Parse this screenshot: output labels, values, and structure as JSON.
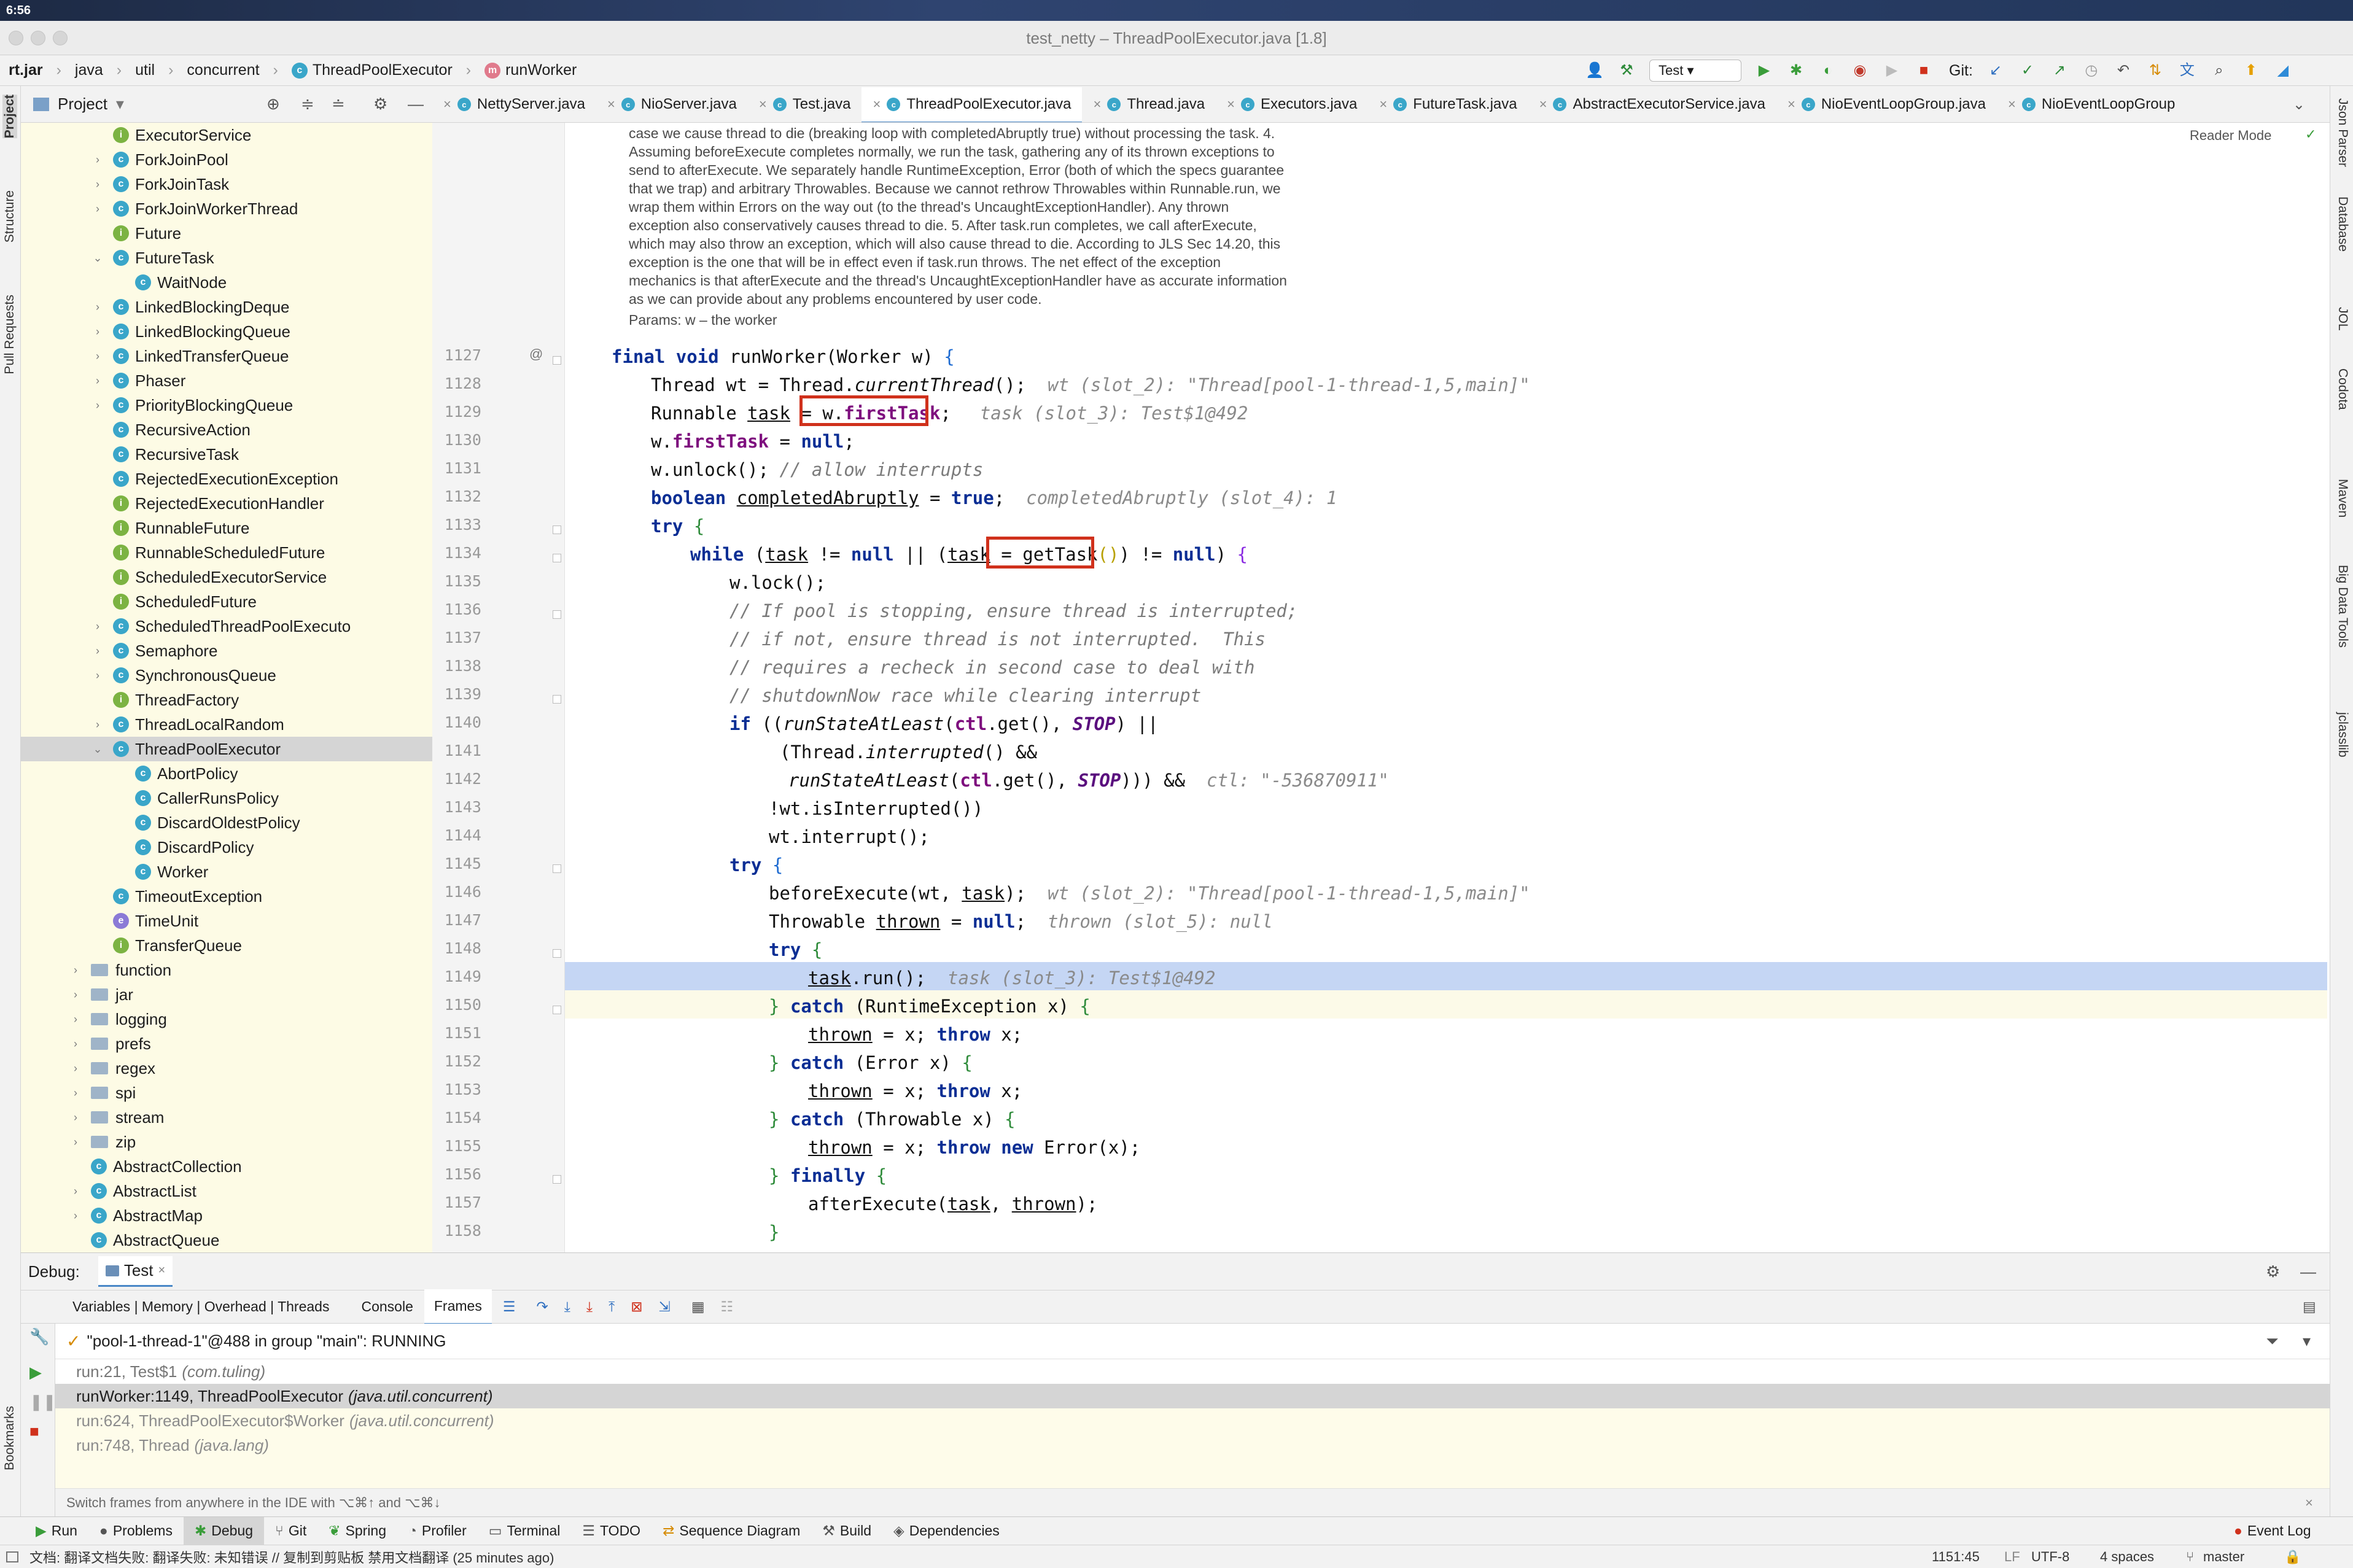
{
  "clock": "6:56",
  "window_title": "test_netty – ThreadPoolExecutor.java [1.8]",
  "breadcrumb": [
    "rt.jar",
    "java",
    "util",
    "concurrent",
    "ThreadPoolExecutor",
    "runWorker"
  ],
  "run_config": "Test",
  "git_label": "Git:",
  "project_panel": {
    "title": "Project",
    "tree": [
      {
        "label": "ExecutorService",
        "icon": "I",
        "arrow": "",
        "indent": 2
      },
      {
        "label": "ForkJoinPool",
        "icon": "C",
        "arrow": "›",
        "indent": 2
      },
      {
        "label": "ForkJoinTask",
        "icon": "C",
        "arrow": "›",
        "indent": 2
      },
      {
        "label": "ForkJoinWorkerThread",
        "icon": "C",
        "arrow": "›",
        "indent": 2
      },
      {
        "label": "Future",
        "icon": "I",
        "arrow": "",
        "indent": 2
      },
      {
        "label": "FutureTask",
        "icon": "C",
        "arrow": "⌄",
        "indent": 2
      },
      {
        "label": "WaitNode",
        "icon": "C",
        "arrow": "",
        "indent": 3
      },
      {
        "label": "LinkedBlockingDeque",
        "icon": "C",
        "arrow": "›",
        "indent": 2
      },
      {
        "label": "LinkedBlockingQueue",
        "icon": "C",
        "arrow": "›",
        "indent": 2
      },
      {
        "label": "LinkedTransferQueue",
        "icon": "C",
        "arrow": "›",
        "indent": 2
      },
      {
        "label": "Phaser",
        "icon": "C",
        "arrow": "›",
        "indent": 2
      },
      {
        "label": "PriorityBlockingQueue",
        "icon": "C",
        "arrow": "›",
        "indent": 2
      },
      {
        "label": "RecursiveAction",
        "icon": "C",
        "arrow": "",
        "indent": 2
      },
      {
        "label": "RecursiveTask",
        "icon": "C",
        "arrow": "",
        "indent": 2
      },
      {
        "label": "RejectedExecutionException",
        "icon": "C",
        "arrow": "",
        "indent": 2
      },
      {
        "label": "RejectedExecutionHandler",
        "icon": "I",
        "arrow": "",
        "indent": 2
      },
      {
        "label": "RunnableFuture",
        "icon": "I",
        "arrow": "",
        "indent": 2
      },
      {
        "label": "RunnableScheduledFuture",
        "icon": "I",
        "arrow": "",
        "indent": 2
      },
      {
        "label": "ScheduledExecutorService",
        "icon": "I",
        "arrow": "",
        "indent": 2
      },
      {
        "label": "ScheduledFuture",
        "icon": "I",
        "arrow": "",
        "indent": 2
      },
      {
        "label": "ScheduledThreadPoolExecuto",
        "icon": "C",
        "arrow": "›",
        "indent": 2
      },
      {
        "label": "Semaphore",
        "icon": "C",
        "arrow": "›",
        "indent": 2
      },
      {
        "label": "SynchronousQueue",
        "icon": "C",
        "arrow": "›",
        "indent": 2
      },
      {
        "label": "ThreadFactory",
        "icon": "I",
        "arrow": "",
        "indent": 2
      },
      {
        "label": "ThreadLocalRandom",
        "icon": "C",
        "arrow": "›",
        "indent": 2
      },
      {
        "label": "ThreadPoolExecutor",
        "icon": "C",
        "arrow": "⌄",
        "indent": 2,
        "selected": true
      },
      {
        "label": "AbortPolicy",
        "icon": "C",
        "arrow": "",
        "indent": 3
      },
      {
        "label": "CallerRunsPolicy",
        "icon": "C",
        "arrow": "",
        "indent": 3
      },
      {
        "label": "DiscardOldestPolicy",
        "icon": "C",
        "arrow": "",
        "indent": 3
      },
      {
        "label": "DiscardPolicy",
        "icon": "C",
        "arrow": "",
        "indent": 3
      },
      {
        "label": "Worker",
        "icon": "C",
        "arrow": "",
        "indent": 3
      },
      {
        "label": "TimeoutException",
        "icon": "C",
        "arrow": "",
        "indent": 2
      },
      {
        "label": "TimeUnit",
        "icon": "E",
        "arrow": "",
        "indent": 2
      },
      {
        "label": "TransferQueue",
        "icon": "I",
        "arrow": "",
        "indent": 2
      },
      {
        "label": "function",
        "icon": "folder",
        "arrow": "›",
        "indent": 1
      },
      {
        "label": "jar",
        "icon": "folder",
        "arrow": "›",
        "indent": 1
      },
      {
        "label": "logging",
        "icon": "folder",
        "arrow": "›",
        "indent": 1
      },
      {
        "label": "prefs",
        "icon": "folder",
        "arrow": "›",
        "indent": 1
      },
      {
        "label": "regex",
        "icon": "folder",
        "arrow": "›",
        "indent": 1
      },
      {
        "label": "spi",
        "icon": "folder",
        "arrow": "›",
        "indent": 1
      },
      {
        "label": "stream",
        "icon": "folder",
        "arrow": "›",
        "indent": 1
      },
      {
        "label": "zip",
        "icon": "folder",
        "arrow": "›",
        "indent": 1
      },
      {
        "label": "AbstractCollection",
        "icon": "C",
        "arrow": "",
        "indent": 1
      },
      {
        "label": "AbstractList",
        "icon": "C",
        "arrow": "›",
        "indent": 1
      },
      {
        "label": "AbstractMap",
        "icon": "C",
        "arrow": "›",
        "indent": 1
      },
      {
        "label": "AbstractQueue",
        "icon": "C",
        "arrow": "",
        "indent": 1
      }
    ]
  },
  "tabs": [
    {
      "label": "NettyServer.java"
    },
    {
      "label": "NioServer.java"
    },
    {
      "label": "Test.java"
    },
    {
      "label": "ThreadPoolExecutor.java",
      "active": true
    },
    {
      "label": "Thread.java"
    },
    {
      "label": "Executors.java"
    },
    {
      "label": "FutureTask.java"
    },
    {
      "label": "AbstractExecutorService.java"
    },
    {
      "label": "NioEventLoopGroup.java"
    },
    {
      "label": "NioEventLoopGroup"
    }
  ],
  "reader_mode": "Reader Mode",
  "javadoc": [
    "case we cause thread to die (breaking loop with completedAbruptly true) without processing the task. 4.",
    "Assuming beforeExecute completes normally, we run the task, gathering any of its thrown exceptions to",
    "send to afterExecute. We separately handle RuntimeException, Error (both of which the specs guarantee",
    "that we trap) and arbitrary Throwables. Because we cannot rethrow Throwables within Runnable.run, we",
    "wrap them within Errors on the way out (to the thread's UncaughtExceptionHandler). Any thrown",
    "exception also conservatively causes thread to die. 5. After task.run completes, we call afterExecute,",
    "which may also throw an exception, which will also cause thread to die. According to JLS Sec 14.20, this",
    "exception is the one that will be in effect even if task.run throws. The net effect of the exception",
    "mechanics is that afterExecute and the thread's UncaughtExceptionHandler have as accurate information",
    "as we can provide about any problems encountered by user code.",
    "Params: w – the worker"
  ],
  "code": {
    "line_numbers": [
      "1127",
      "1128",
      "1129",
      "1130",
      "1131",
      "1132",
      "1133",
      "1134",
      "1135",
      "1136",
      "1137",
      "1138",
      "1139",
      "1140",
      "1141",
      "1142",
      "1143",
      "1144",
      "1145",
      "1146",
      "1147",
      "1148",
      "1149",
      "1150",
      "1151",
      "1152",
      "1153",
      "1154",
      "1155",
      "1156",
      "1157",
      "1158"
    ],
    "hints": {
      "l1128": "wt (slot_2): \"Thread[pool-1-thread-1,5,main]\"",
      "l1129": "task (slot_3): Test$1@492",
      "l1132": "completedAbruptly (slot_4): 1",
      "l1142": "ctl: \"-536870911\"",
      "l1146": "wt (slot_2): \"Thread[pool-1-thread-1,5,main]\"",
      "l1147": "thrown (slot_5): null",
      "l1149": "task (slot_3): Test$1@492"
    },
    "comments": {
      "c1131": "// allow interrupts",
      "c1136": "// If pool is stopping, ensure thread is interrupted;",
      "c1137": "// if not, ensure thread is not interrupted.  This",
      "c1138": "// requires a recheck in second case to deal with",
      "c1139": "// shutdownNow race while clearing interrupt"
    }
  },
  "debug": {
    "label": "Debug:",
    "session": "Test",
    "tabs": [
      "Variables | Memory | Overhead | Threads",
      "Console",
      "Frames"
    ],
    "thread": "\"pool-1-thread-1\"@488 in group \"main\": RUNNING",
    "frames": [
      {
        "method": "run:21, Test$1",
        "pkg": "(com.tuling)",
        "state": "normal"
      },
      {
        "method": "runWorker:1149, ThreadPoolExecutor",
        "pkg": "(java.util.concurrent)",
        "state": "selected"
      },
      {
        "method": "run:624, ThreadPoolExecutor$Worker",
        "pkg": "(java.util.concurrent)",
        "state": "dim"
      },
      {
        "method": "run:748, Thread",
        "pkg": "(java.lang)",
        "state": "dim"
      }
    ],
    "hint": "Switch frames from anywhere in the IDE with ⌥⌘↑ and ⌥⌘↓"
  },
  "tool_windows": [
    "Run",
    "Problems",
    "Debug",
    "Git",
    "Spring",
    "Profiler",
    "Terminal",
    "TODO",
    "Sequence Diagram",
    "Build",
    "Dependencies"
  ],
  "event_log": "Event Log",
  "status": {
    "message": "文档: 翻译文档失败: 翻译失败: 未知错误 // 复制到剪贴板   禁用文档翻译 (25 minutes ago)",
    "position": "1151:45",
    "line_sep": "LF",
    "encoding": "UTF-8",
    "indent": "4 spaces",
    "branch": "master"
  },
  "left_strip": [
    "Project",
    "Structure",
    "Pull Requests",
    "Bookmarks"
  ],
  "right_strip": [
    "Json Parser",
    "Database",
    "JOL",
    "Codota",
    "Maven",
    "Big Data Tools",
    "jclasslib"
  ]
}
